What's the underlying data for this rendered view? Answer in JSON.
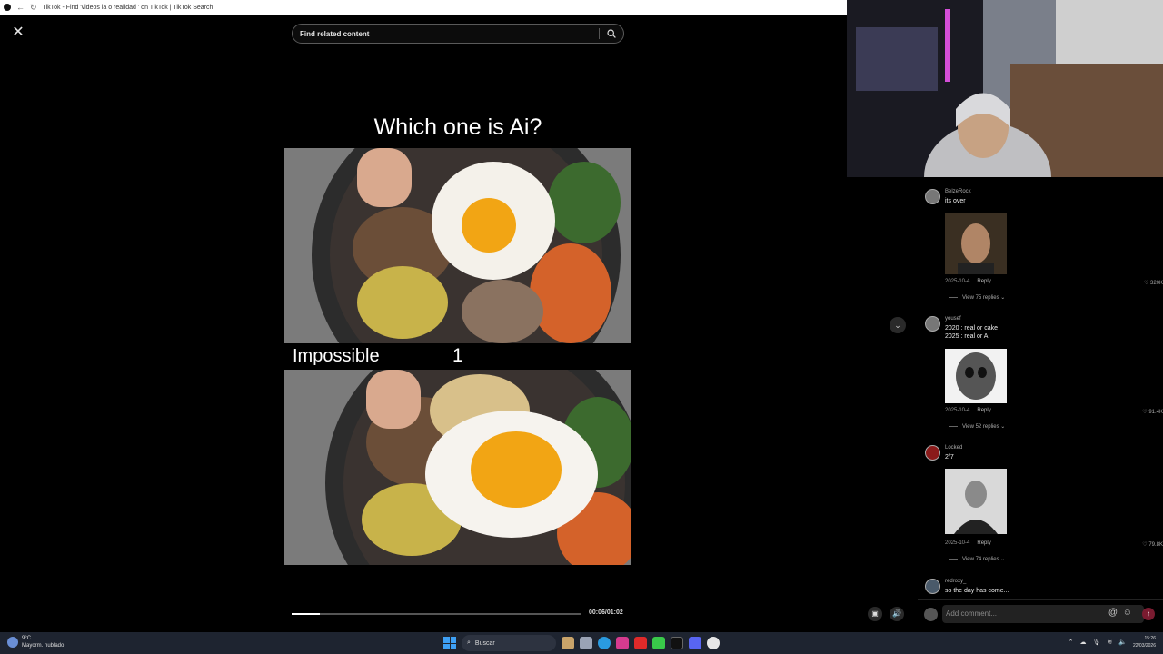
{
  "browser": {
    "tab_title": "TikTok - Find 'videos ia o realidad ' on TikTok | TikTok Search"
  },
  "search": {
    "placeholder": "Find related content"
  },
  "video": {
    "headline": "Which one is Ai?",
    "overlay_label": "Impossible",
    "overlay_number": "1",
    "time_display": "00:06/01:02",
    "progress_fraction": 0.097
  },
  "comments": [
    {
      "user": "BelzeRock",
      "text": "its over",
      "date": "2025-10-4",
      "reply_label": "Reply",
      "likes": "320K",
      "replies": "View 75 replies"
    },
    {
      "user": "yousef",
      "text_line1": "2020 : real or cake",
      "text_line2": "2025 : real or AI",
      "date": "2025-10-4",
      "reply_label": "Reply",
      "likes": "91.4K",
      "replies": "View 52 replies"
    },
    {
      "user": "Locked",
      "text": "2/7",
      "date": "2025-10-4",
      "reply_label": "Reply",
      "likes": "79.8K",
      "replies": "View 74 replies"
    },
    {
      "user": "redroxy_",
      "text": "so the day has come..."
    }
  ],
  "compose": {
    "placeholder": "Add comment..."
  },
  "taskbar": {
    "temperature": "9°C",
    "weather_text": "Mayorm. nublado",
    "search_label": "Buscar",
    "time": "15:26",
    "date": "22/03/2026"
  },
  "colors": {
    "send_button": "#7a1b30",
    "taskbar": "#1e2430"
  }
}
